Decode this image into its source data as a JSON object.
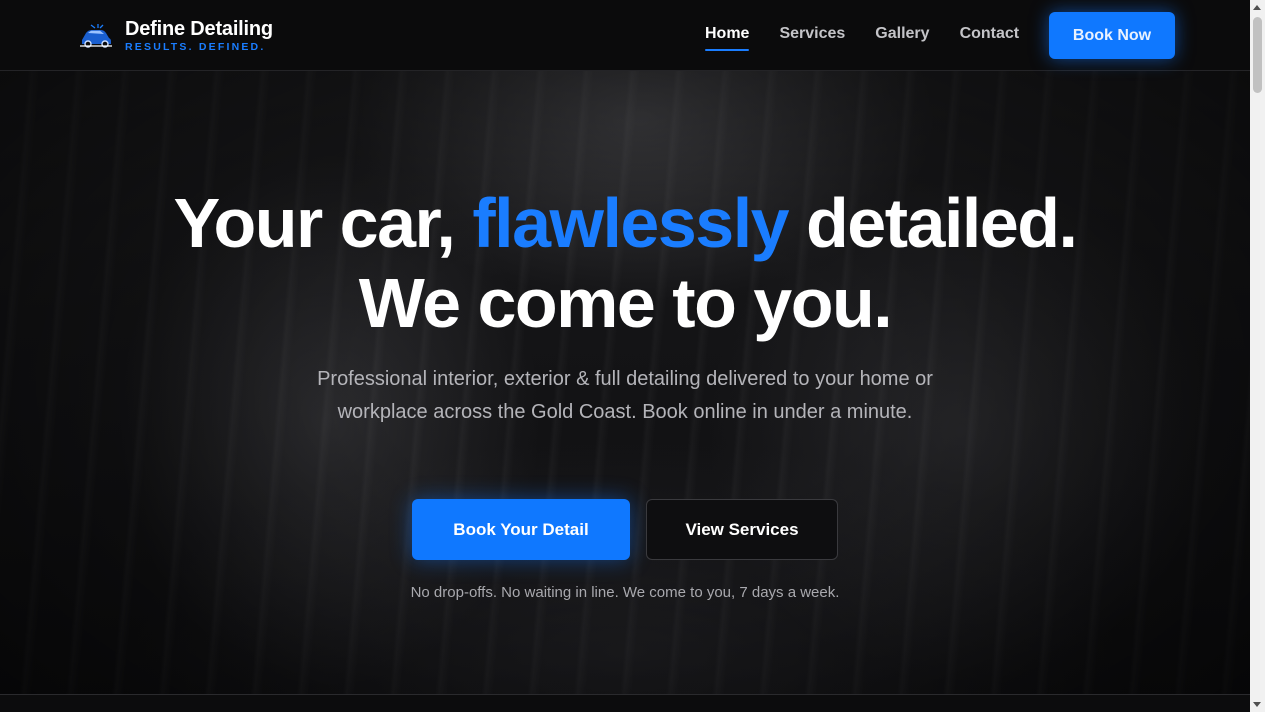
{
  "brand": {
    "name": "Define Detailing",
    "tagline": "RESULTS. DEFINED.",
    "logo_icon": "car-logo-icon"
  },
  "nav": {
    "links": [
      {
        "label": "Home",
        "active": true
      },
      {
        "label": "Services",
        "active": false
      },
      {
        "label": "Gallery",
        "active": false
      },
      {
        "label": "Contact",
        "active": false
      }
    ],
    "cta_label": "Book Now"
  },
  "hero": {
    "headline_part1": "Your car, ",
    "headline_accent": "flawlessly",
    "headline_part2": " detailed.",
    "headline_line2": "We come to you.",
    "subtext": "Professional interior, exterior & full detailing delivered to your home or workplace across the Gold Coast. Book online in under a minute.",
    "primary_cta": "Book Your Detail",
    "secondary_cta": "View Services",
    "note": "No drop-offs. No waiting in line. We come to you, 7 days a week."
  },
  "colors": {
    "accent": "#1a7dff",
    "background": "#0b0b0c"
  }
}
